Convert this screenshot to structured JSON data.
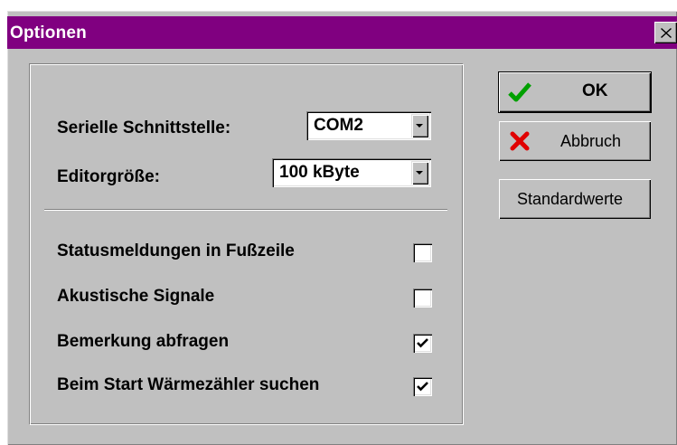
{
  "window": {
    "title": "Optionen",
    "close_glyph": "✕"
  },
  "settings": {
    "serial_port": {
      "label": "Serielle Schnittstelle:",
      "value": "COM2"
    },
    "editor_size": {
      "label": "Editorgröße:",
      "value": "100 kByte"
    }
  },
  "options": [
    {
      "label": "Statusmeldungen in Fußzeile",
      "checked": false
    },
    {
      "label": "Akustische Signale",
      "checked": false
    },
    {
      "label": "Bemerkung abfragen",
      "checked": true
    },
    {
      "label": "Beim Start Wärmezähler suchen",
      "checked": true
    }
  ],
  "buttons": {
    "ok": {
      "label": "OK",
      "icon": "checkmark-icon"
    },
    "cancel": {
      "label": "Abbruch",
      "icon": "red-x-icon"
    },
    "defaults": {
      "label": "Standardwerte"
    }
  },
  "colors": {
    "titlebar": "#800080",
    "face": "#c0c0c0",
    "ok_check": "#00a000",
    "cancel_x": "#e00000"
  }
}
